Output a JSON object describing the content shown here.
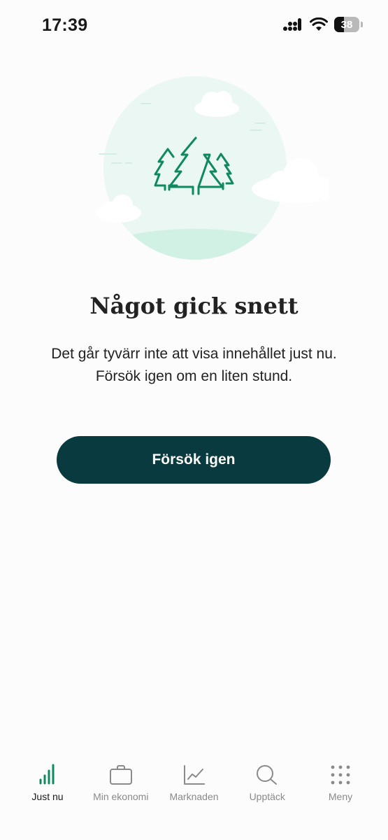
{
  "status_bar": {
    "time": "17:39",
    "battery": "38"
  },
  "error": {
    "title": "Något gick snett",
    "message": "Det går tyvärr inte att visa innehållet just nu. Försök igen om en liten stund.",
    "retry_label": "Försök igen"
  },
  "colors": {
    "accent": "#083a3f",
    "tree_green": "#0f8a60",
    "circle_mint": "#eaf7f2"
  },
  "tabs": [
    {
      "label": "Just nu",
      "icon": "signal-bars-icon",
      "active": true
    },
    {
      "label": "Min ekonomi",
      "icon": "briefcase-icon",
      "active": false
    },
    {
      "label": "Marknaden",
      "icon": "chart-line-icon",
      "active": false
    },
    {
      "label": "Upptäck",
      "icon": "search-icon",
      "active": false
    },
    {
      "label": "Meny",
      "icon": "grid-dots-icon",
      "active": false
    }
  ]
}
